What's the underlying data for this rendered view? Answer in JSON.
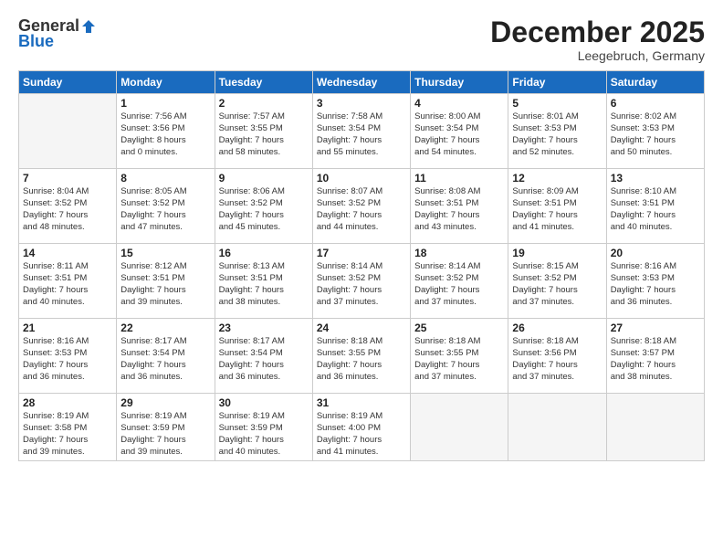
{
  "header": {
    "logo_general": "General",
    "logo_blue": "Blue",
    "month_title": "December 2025",
    "location": "Leegebruch, Germany"
  },
  "days_of_week": [
    "Sunday",
    "Monday",
    "Tuesday",
    "Wednesday",
    "Thursday",
    "Friday",
    "Saturday"
  ],
  "weeks": [
    [
      {
        "day": "",
        "info": ""
      },
      {
        "day": "1",
        "info": "Sunrise: 7:56 AM\nSunset: 3:56 PM\nDaylight: 8 hours\nand 0 minutes."
      },
      {
        "day": "2",
        "info": "Sunrise: 7:57 AM\nSunset: 3:55 PM\nDaylight: 7 hours\nand 58 minutes."
      },
      {
        "day": "3",
        "info": "Sunrise: 7:58 AM\nSunset: 3:54 PM\nDaylight: 7 hours\nand 55 minutes."
      },
      {
        "day": "4",
        "info": "Sunrise: 8:00 AM\nSunset: 3:54 PM\nDaylight: 7 hours\nand 54 minutes."
      },
      {
        "day": "5",
        "info": "Sunrise: 8:01 AM\nSunset: 3:53 PM\nDaylight: 7 hours\nand 52 minutes."
      },
      {
        "day": "6",
        "info": "Sunrise: 8:02 AM\nSunset: 3:53 PM\nDaylight: 7 hours\nand 50 minutes."
      }
    ],
    [
      {
        "day": "7",
        "info": "Sunrise: 8:04 AM\nSunset: 3:52 PM\nDaylight: 7 hours\nand 48 minutes."
      },
      {
        "day": "8",
        "info": "Sunrise: 8:05 AM\nSunset: 3:52 PM\nDaylight: 7 hours\nand 47 minutes."
      },
      {
        "day": "9",
        "info": "Sunrise: 8:06 AM\nSunset: 3:52 PM\nDaylight: 7 hours\nand 45 minutes."
      },
      {
        "day": "10",
        "info": "Sunrise: 8:07 AM\nSunset: 3:52 PM\nDaylight: 7 hours\nand 44 minutes."
      },
      {
        "day": "11",
        "info": "Sunrise: 8:08 AM\nSunset: 3:51 PM\nDaylight: 7 hours\nand 43 minutes."
      },
      {
        "day": "12",
        "info": "Sunrise: 8:09 AM\nSunset: 3:51 PM\nDaylight: 7 hours\nand 41 minutes."
      },
      {
        "day": "13",
        "info": "Sunrise: 8:10 AM\nSunset: 3:51 PM\nDaylight: 7 hours\nand 40 minutes."
      }
    ],
    [
      {
        "day": "14",
        "info": "Sunrise: 8:11 AM\nSunset: 3:51 PM\nDaylight: 7 hours\nand 40 minutes."
      },
      {
        "day": "15",
        "info": "Sunrise: 8:12 AM\nSunset: 3:51 PM\nDaylight: 7 hours\nand 39 minutes."
      },
      {
        "day": "16",
        "info": "Sunrise: 8:13 AM\nSunset: 3:51 PM\nDaylight: 7 hours\nand 38 minutes."
      },
      {
        "day": "17",
        "info": "Sunrise: 8:14 AM\nSunset: 3:52 PM\nDaylight: 7 hours\nand 37 minutes."
      },
      {
        "day": "18",
        "info": "Sunrise: 8:14 AM\nSunset: 3:52 PM\nDaylight: 7 hours\nand 37 minutes."
      },
      {
        "day": "19",
        "info": "Sunrise: 8:15 AM\nSunset: 3:52 PM\nDaylight: 7 hours\nand 37 minutes."
      },
      {
        "day": "20",
        "info": "Sunrise: 8:16 AM\nSunset: 3:53 PM\nDaylight: 7 hours\nand 36 minutes."
      }
    ],
    [
      {
        "day": "21",
        "info": "Sunrise: 8:16 AM\nSunset: 3:53 PM\nDaylight: 7 hours\nand 36 minutes."
      },
      {
        "day": "22",
        "info": "Sunrise: 8:17 AM\nSunset: 3:54 PM\nDaylight: 7 hours\nand 36 minutes."
      },
      {
        "day": "23",
        "info": "Sunrise: 8:17 AM\nSunset: 3:54 PM\nDaylight: 7 hours\nand 36 minutes."
      },
      {
        "day": "24",
        "info": "Sunrise: 8:18 AM\nSunset: 3:55 PM\nDaylight: 7 hours\nand 36 minutes."
      },
      {
        "day": "25",
        "info": "Sunrise: 8:18 AM\nSunset: 3:55 PM\nDaylight: 7 hours\nand 37 minutes."
      },
      {
        "day": "26",
        "info": "Sunrise: 8:18 AM\nSunset: 3:56 PM\nDaylight: 7 hours\nand 37 minutes."
      },
      {
        "day": "27",
        "info": "Sunrise: 8:18 AM\nSunset: 3:57 PM\nDaylight: 7 hours\nand 38 minutes."
      }
    ],
    [
      {
        "day": "28",
        "info": "Sunrise: 8:19 AM\nSunset: 3:58 PM\nDaylight: 7 hours\nand 39 minutes."
      },
      {
        "day": "29",
        "info": "Sunrise: 8:19 AM\nSunset: 3:59 PM\nDaylight: 7 hours\nand 39 minutes."
      },
      {
        "day": "30",
        "info": "Sunrise: 8:19 AM\nSunset: 3:59 PM\nDaylight: 7 hours\nand 40 minutes."
      },
      {
        "day": "31",
        "info": "Sunrise: 8:19 AM\nSunset: 4:00 PM\nDaylight: 7 hours\nand 41 minutes."
      },
      {
        "day": "",
        "info": ""
      },
      {
        "day": "",
        "info": ""
      },
      {
        "day": "",
        "info": ""
      }
    ]
  ]
}
